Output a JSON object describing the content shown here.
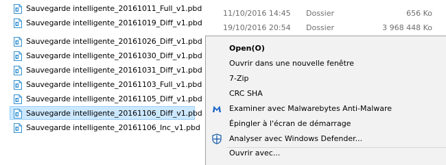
{
  "files": [
    {
      "name": "Sauvegarde intelligente_20161011_Full_v1.pbd",
      "date": "11/10/2016 14:45",
      "type": "Dossier",
      "size": "656 Ko"
    },
    {
      "name": "Sauvegarde intelligente_20161019_Diff_v1.pbd",
      "date": "19/10/2016 20:54",
      "type": "Dossier",
      "size": "3 968 448 Ko"
    },
    {
      "name": "Sauvegarde intelligente_20161026_Diff_v1.pbd"
    },
    {
      "name": "Sauvegarde intelligente_20161030_Diff_v1.pbd"
    },
    {
      "name": "Sauvegarde intelligente_20161031_Diff_v1.pbd"
    },
    {
      "name": "Sauvegarde intelligente_20161103_Full_v1.pbd"
    },
    {
      "name": "Sauvegarde intelligente_20161105_Diff_v1.pbd"
    },
    {
      "name": "Sauvegarde intelligente_20161106_Diff_v1.pbd",
      "selected": true
    },
    {
      "name": "Sauvegarde intelligente_20161106_Inc_v1.pbd"
    }
  ],
  "context_menu": {
    "items": [
      {
        "label": "Open(O)",
        "bold": true
      },
      {
        "label": "Ouvrir dans une nouvelle fenêtre"
      },
      {
        "label": "7-Zip"
      },
      {
        "label": "CRC SHA"
      },
      {
        "label": "Examiner avec Malwarebytes Anti-Malware",
        "icon": "malwarebytes-icon"
      },
      {
        "label": "Épingler à l'écran de démarrage"
      },
      {
        "label": "Analyser avec Windows Defender...",
        "icon": "windows-defender-icon"
      },
      {
        "label": "Ouvrir avec..."
      }
    ]
  },
  "colors": {
    "selection_bg": "#cce8ff",
    "selection_border": "#99d1ff",
    "menu_bg": "#f2f2f2",
    "file_icon_accent": "#2f8fd0"
  }
}
